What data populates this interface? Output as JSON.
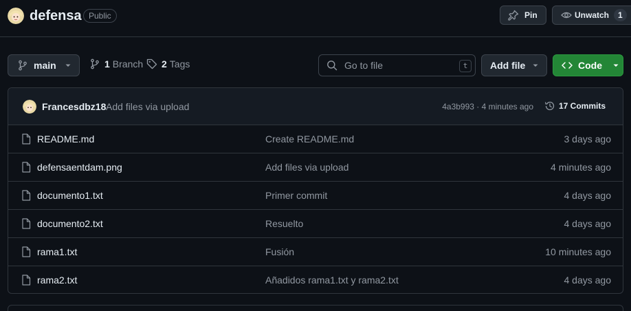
{
  "repo": {
    "name": "defensa",
    "visibility": "Public"
  },
  "actions": {
    "pin_label": "Pin",
    "unwatch_label": "Unwatch",
    "watch_count": "1"
  },
  "toolbar": {
    "branch": "main",
    "branch_count": "1",
    "branch_label": "Branch",
    "tag_count": "2",
    "tag_label": "Tags",
    "search_placeholder": "Go to file",
    "search_shortcut": "t",
    "add_file_label": "Add file",
    "code_label": "Code"
  },
  "latest_commit": {
    "author": "Francesdbz18",
    "message": "Add files via upload",
    "meta": "4a3b993 · 4 minutes ago",
    "commits_label": "17 Commits"
  },
  "files": [
    {
      "name": "README.md",
      "commit": "Create README.md",
      "date": "3 days ago"
    },
    {
      "name": "defensaentdam.png",
      "commit": "Add files via upload",
      "date": "4 minutes ago"
    },
    {
      "name": "documento1.txt",
      "commit": "Primer commit",
      "date": "4 days ago"
    },
    {
      "name": "documento2.txt",
      "commit": "Resuelto",
      "date": "4 days ago"
    },
    {
      "name": "rama1.txt",
      "commit": "Fusión",
      "date": "10 minutes ago"
    },
    {
      "name": "rama2.txt",
      "commit": "Añadidos rama1.txt y rama2.txt",
      "date": "4 days ago"
    }
  ],
  "colors": {
    "background": "#0d1117",
    "border": "#30363d",
    "code_button": "#238636"
  },
  "icons": [
    "avatar",
    "pin-icon",
    "eye-icon",
    "git-branch-icon",
    "tag-icon",
    "search-icon",
    "code-icon",
    "history-icon",
    "file-icon",
    "chevron-down-icon"
  ]
}
